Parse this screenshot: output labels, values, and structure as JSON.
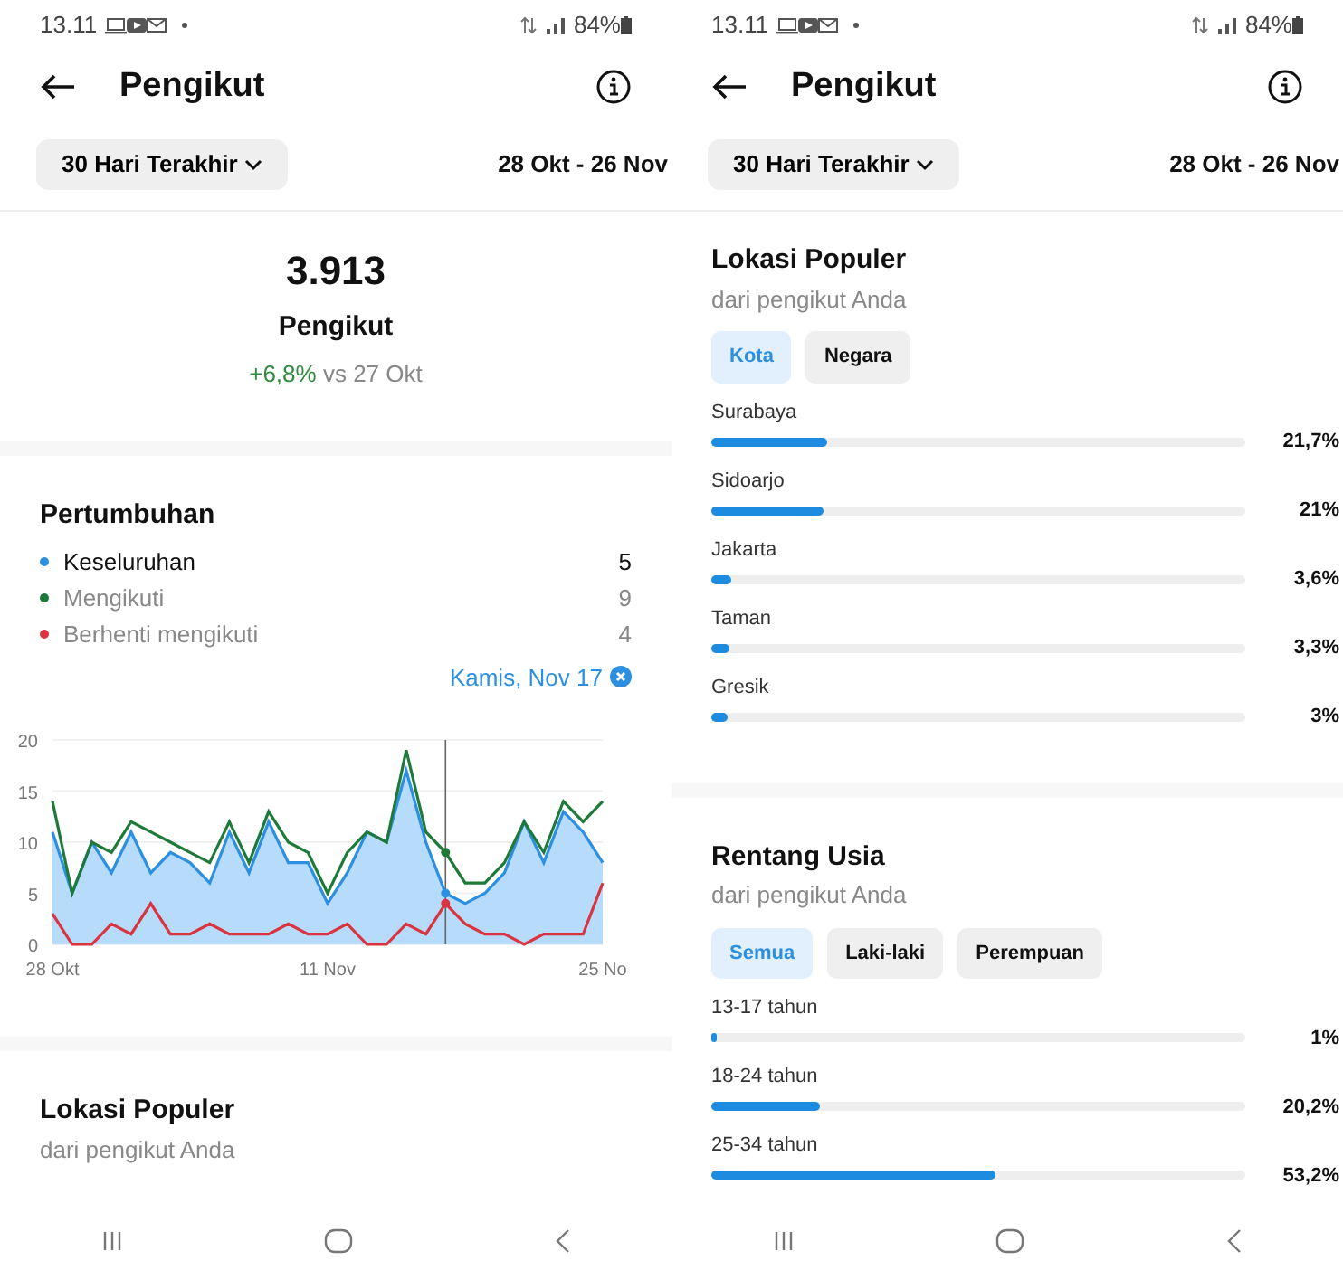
{
  "screens": [
    {
      "status_bar": {
        "time": "13.11",
        "battery": "84%"
      },
      "header": {
        "title": "Pengikut"
      },
      "filter": {
        "label": "30 Hari Terakhir",
        "range": "28 Okt - 26 Nov"
      },
      "sections": [
        {
          "kind": "summary",
          "count": "3.913",
          "label": "Pengikut",
          "change": "+6,8%",
          "compare": "vs 27 Okt"
        },
        {
          "kind": "growth",
          "title": "Pertumbuhan",
          "legend": [
            {
              "value": "5",
              "selected": true
            },
            {
              "value": "9",
              "selected": false
            },
            {
              "value": "4",
              "selected": false
            }
          ],
          "selection": "Kamis, Nov 17",
          "chart_data": {
            "type": "line",
            "grid": true,
            "categories": [
              "28 Okt",
              null,
              null,
              null,
              null,
              null,
              null,
              null,
              null,
              null,
              null,
              null,
              null,
              null,
              "11 Nov",
              null,
              null,
              null,
              null,
              null,
              null,
              null,
              null,
              null,
              null,
              null,
              null,
              null,
              "25 No"
            ],
            "series": [
              {
                "name": "Keseluruhan",
                "color": "#2d8fe0",
                "type": "area",
                "values": [
                  11,
                  5,
                  10,
                  7,
                  11,
                  7,
                  9,
                  8,
                  6,
                  11,
                  7,
                  12,
                  8,
                  8,
                  4,
                  7,
                  11,
                  10,
                  17,
                  10,
                  5,
                  4,
                  5,
                  7,
                  12,
                  8,
                  13,
                  11,
                  8
                ]
              },
              {
                "name": "Mengikuti",
                "color": "#1f7a3a",
                "values": [
                  14,
                  5,
                  10,
                  9,
                  12,
                  11,
                  10,
                  9,
                  8,
                  12,
                  8,
                  13,
                  10,
                  9,
                  5,
                  9,
                  11,
                  10,
                  19,
                  11,
                  9,
                  6,
                  6,
                  8,
                  12,
                  9,
                  14,
                  12,
                  14
                ]
              },
              {
                "name": "Berhenti mengikuti",
                "color": "#d9343f",
                "values": [
                  3,
                  0,
                  0,
                  2,
                  1,
                  4,
                  1,
                  1,
                  2,
                  1,
                  1,
                  1,
                  2,
                  1,
                  1,
                  2,
                  0,
                  0,
                  2,
                  1,
                  4,
                  2,
                  1,
                  1,
                  0,
                  1,
                  1,
                  1,
                  6
                ]
              }
            ],
            "ylim": [
              0,
              20
            ],
            "yticks": [
              0,
              5,
              10,
              15,
              20
            ]
          }
        },
        {
          "kind": "breakdown",
          "title": "Lokasi Populer",
          "subtitle": "dari pengikut Anda"
        }
      ]
    },
    {
      "status_bar": {
        "time": "13.11",
        "battery": "84%"
      },
      "header": {
        "title": "Pengikut"
      },
      "filter": {
        "label": "30 Hari Terakhir",
        "range": "28 Okt - 26 Nov"
      },
      "sections": [
        {
          "kind": "breakdown",
          "title": "Lokasi Populer",
          "subtitle": "dari pengikut Anda",
          "tabs": [
            {
              "label": "Kota",
              "selected": true
            },
            {
              "label": "Negara",
              "selected": false
            }
          ],
          "rows": [
            {
              "label": "Surabaya",
              "level": 0.217,
              "value": "21,7%"
            },
            {
              "label": "Sidoarjo",
              "level": 0.21,
              "value": "21%"
            },
            {
              "label": "Jakarta",
              "level": 0.036,
              "value": "3,6%"
            },
            {
              "label": "Taman",
              "level": 0.033,
              "value": "3,3%"
            },
            {
              "label": "Gresik",
              "level": 0.03,
              "value": "3%"
            }
          ]
        },
        {
          "kind": "breakdown",
          "title": "Rentang Usia",
          "subtitle": "dari pengikut Anda",
          "tabs": [
            {
              "label": "Semua",
              "selected": true
            },
            {
              "label": "Laki-laki",
              "selected": false
            },
            {
              "label": "Perempuan",
              "selected": false
            }
          ],
          "rows": [
            {
              "label": "13-17 tahun",
              "level": 0.01,
              "value": "1%"
            },
            {
              "label": "18-24 tahun",
              "level": 0.202,
              "value": "20,2%"
            },
            {
              "label": "25-34 tahun",
              "level": 0.532,
              "value": "53,2%"
            }
          ]
        }
      ]
    }
  ]
}
